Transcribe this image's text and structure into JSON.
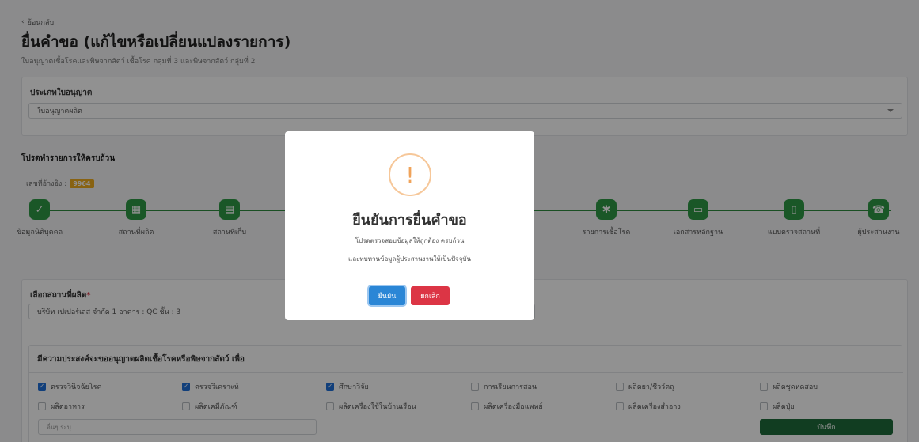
{
  "header": {
    "back_label": "ย้อนกลับ",
    "title": "ยื่นคำขอ (แก้ไขหรือเปลี่ยนแปลงรายการ)",
    "subtitle": "ใบอนุญาตเชื้อโรคและพิษจากสัตว์ เชื้อโรค กลุ่มที่ 3 และพิษจากสัตว์ กลุ่มที่ 2"
  },
  "license_type": {
    "label": "ประเภทใบอนุญาต",
    "value": "ใบอนุญาตผลิต"
  },
  "steps_section": {
    "heading": "โปรดทำรายการให้ครบถ้วน",
    "ref_label": "เลขที่อ้างอิง :",
    "ref_number": "9964",
    "steps": [
      {
        "label": "ข้อมูลนิติบุคคล",
        "icon": "check-icon"
      },
      {
        "label": "สถานที่ผลิต",
        "icon": "building-icon"
      },
      {
        "label": "สถานที่เก็บ",
        "icon": "archive-icon"
      },
      {
        "label": "รายการเชื้อโรค",
        "icon": "virus-icon"
      },
      {
        "label": "เอกสารหลักฐาน",
        "icon": "document-icon"
      },
      {
        "label": "แบบตรวจสถานที่",
        "icon": "clipboard-icon"
      },
      {
        "label": "ผู้ประสานงาน",
        "icon": "phone-icon"
      }
    ]
  },
  "facility": {
    "label": "เลือกสถานที่ผลิต",
    "required_mark": "*",
    "value": "บริษัท เปเปอร์เลส จำกัด 1 อาคาร : QC ชั้น : 3"
  },
  "purpose": {
    "heading": "มีความประสงค์จะขออนุญาตผลิตเชื้อโรคหรือพิษจากสัตว์ เพื่อ",
    "options": [
      {
        "label": "ตรวจวินิจฉัยโรค",
        "checked": true
      },
      {
        "label": "ตรวจวิเคราะห์",
        "checked": true
      },
      {
        "label": "ศึกษาวิจัย",
        "checked": true
      },
      {
        "label": "การเรียนการสอน",
        "checked": false
      },
      {
        "label": "ผลิตยา/ชีววัตถุ",
        "checked": false
      },
      {
        "label": "ผลิตชุดทดสอบ",
        "checked": false
      },
      {
        "label": "ผลิตอาหาร",
        "checked": false
      },
      {
        "label": "ผลิตเคมีภัณฑ์",
        "checked": false
      },
      {
        "label": "ผลิตเครื่องใช้ในบ้านเรือน",
        "checked": false
      },
      {
        "label": "ผลิตเครื่องมือแพทย์",
        "checked": false
      },
      {
        "label": "ผลิตเครื่องสำอาง",
        "checked": false
      },
      {
        "label": "ผลิตปุ๋ย",
        "checked": false
      }
    ],
    "other_placeholder": "อื่นๆ ระบุ...",
    "save_label": "บันทึก"
  },
  "modal": {
    "icon": "exclamation-icon",
    "title": "ยืนยันการยื่นคำขอ",
    "line1": "โปรดตรวจสอบข้อมูลให้ถูกต้อง ครบถ้วน",
    "line2": "และทบทวนข้อมูลผู้ประสานงานให้เป็นปัจจุบัน",
    "confirm_label": "ยืนยัน",
    "cancel_label": "ยกเลิก"
  },
  "colors": {
    "step_green": "#2f9a45",
    "confirm_blue": "#2a86d6",
    "cancel_red": "#dc3545",
    "ref_badge": "#f0ad1e",
    "save_green": "#1f6b3a"
  }
}
